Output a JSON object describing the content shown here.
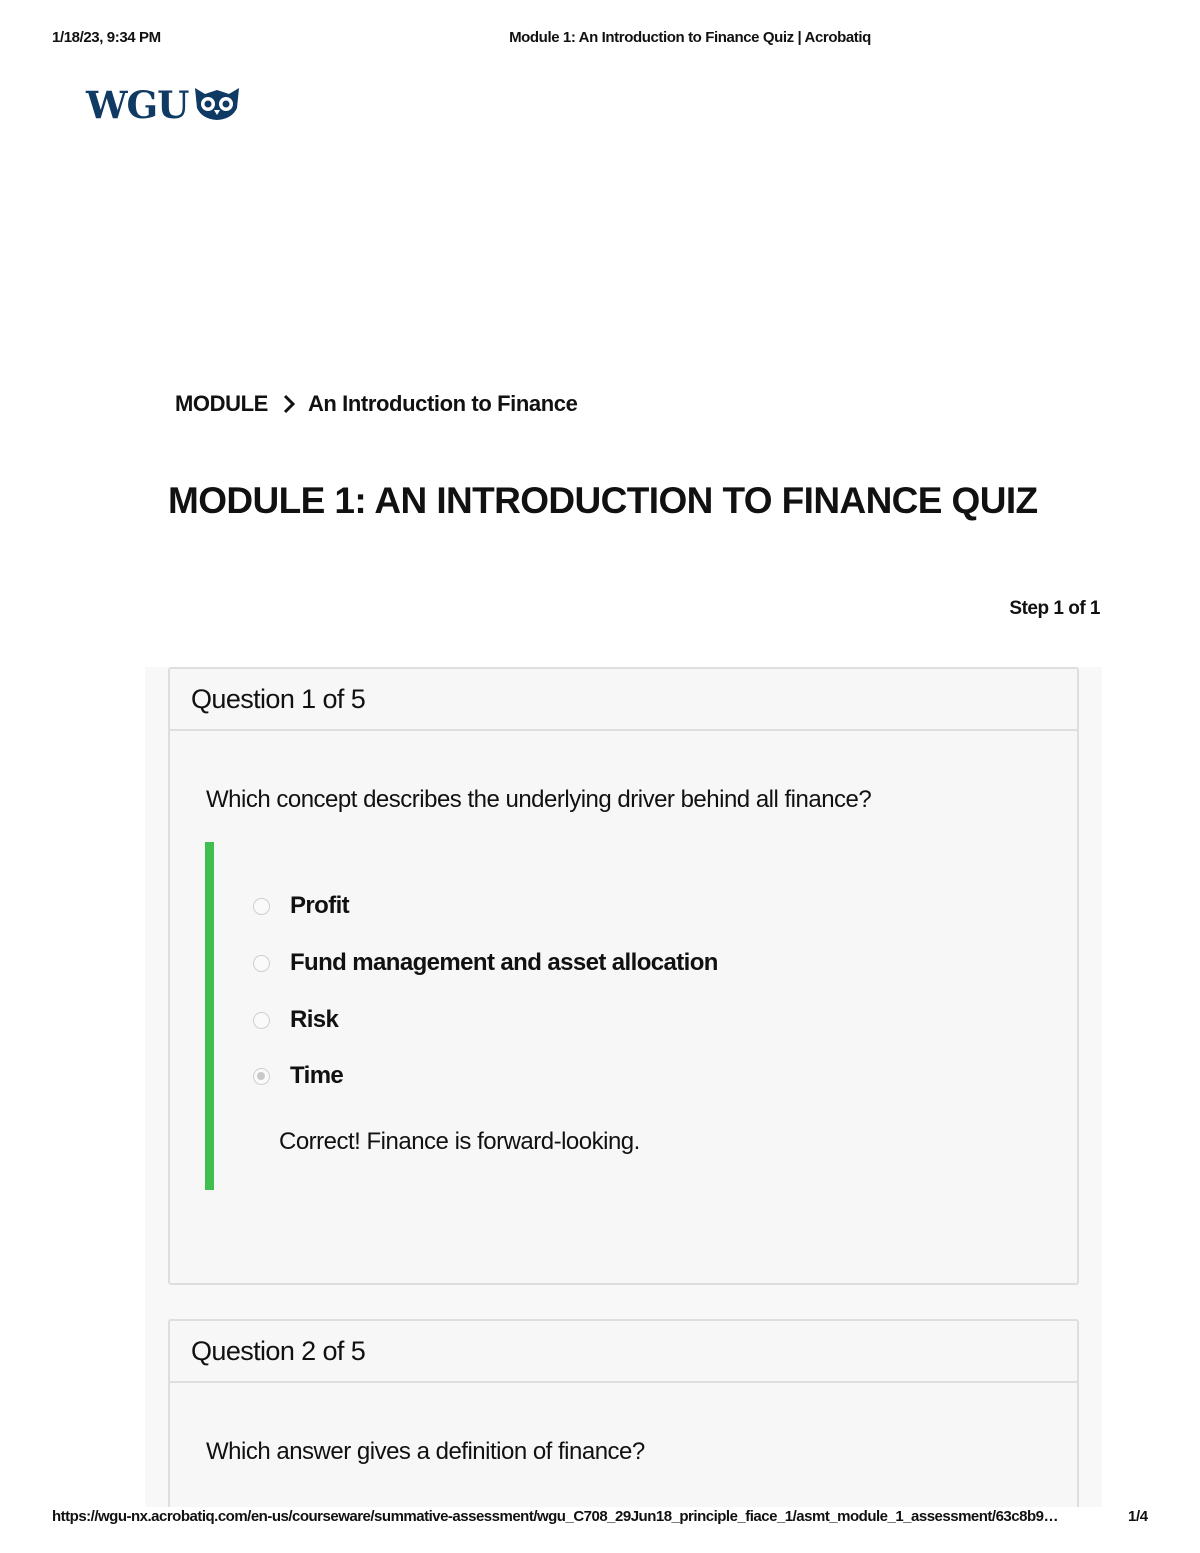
{
  "print_header": {
    "datetime": "1/18/23, 9:34 PM",
    "doc_title": "Module 1: An Introduction to Finance Quiz | Acrobatiq"
  },
  "logo": {
    "text": "WGU",
    "icon": "owl-icon"
  },
  "breadcrumb": {
    "root": "MODULE",
    "current": "An Introduction to Finance",
    "separator_icon": "chevron-right-icon"
  },
  "page_title": "MODULE 1: AN INTRODUCTION TO FINANCE QUIZ",
  "step": "Step 1 of 1",
  "questions": [
    {
      "header": "Question 1 of 5",
      "text": "Which concept describes the underlying driver behind all finance?",
      "options": [
        "Profit",
        "Fund management and asset allocation",
        "Risk",
        "Time"
      ],
      "selected": "Time",
      "feedback": "Correct! Finance is forward-looking."
    },
    {
      "header": "Question 2 of 5",
      "text": "Which answer gives a definition of finance?"
    }
  ],
  "colors": {
    "logo": "#0f3a64",
    "correct_bar": "#3fbf4f"
  },
  "print_footer": {
    "url": "https://wgu-nx.acrobatiq.com/en-us/courseware/summative-assessment/wgu_C708_29Jun18_principle_fiace_1/asmt_module_1_assessment/63c8b9…",
    "page": "1/4"
  }
}
